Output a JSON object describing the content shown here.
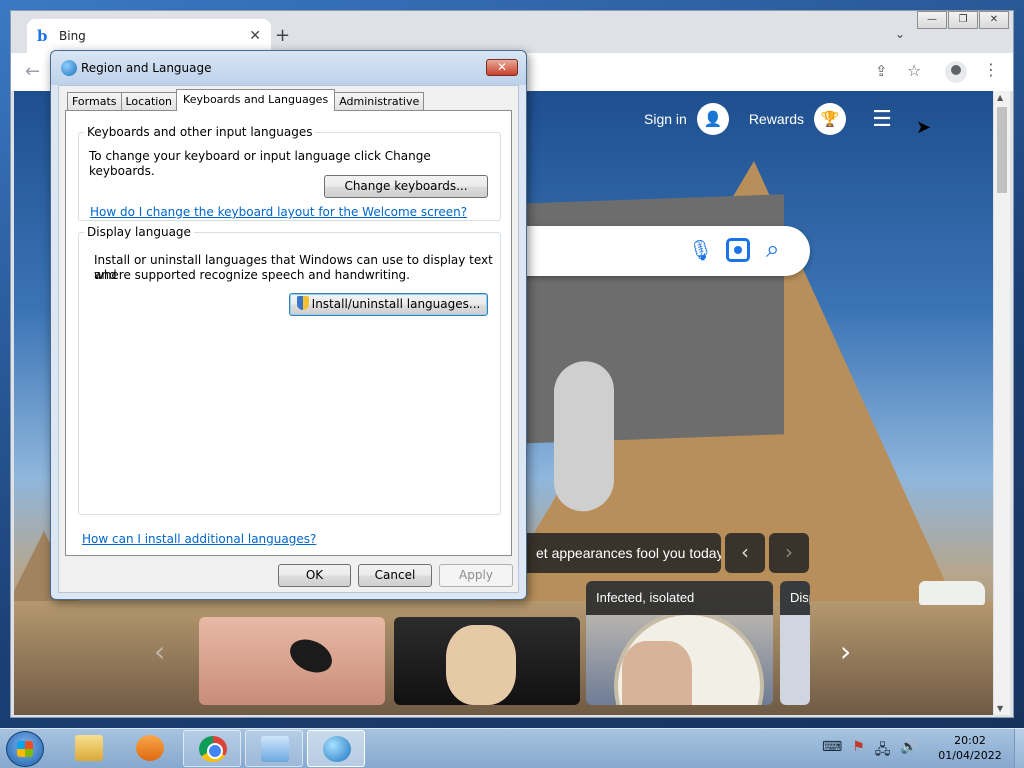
{
  "browser": {
    "tab_title": "Bing",
    "tab_close_glyph": "✕",
    "new_tab_glyph": "+",
    "tab_search_glyph": "⌄",
    "back_glyph": "←",
    "share_glyph": "⇪",
    "bookmark_glyph": "☆",
    "menu_glyph": "⋮",
    "caption": {
      "minimize": "—",
      "restore": "❐",
      "close": "✕"
    }
  },
  "bing": {
    "signin_label": "Sign in",
    "signin_icon": "user-icon",
    "rewards_label": "Rewards",
    "rewards_icon": "trophy-icon",
    "hamburger_glyph": "☰",
    "mic_glyph": "🎙",
    "search_glyph": "⌕",
    "headline": "et appearances fool you today",
    "prev_glyph": "‹",
    "next_glyph": "›",
    "carousel_right_glyph": "›",
    "carousel_left_glyph": "‹",
    "cards": [
      {
        "title": ""
      },
      {
        "title": ""
      },
      {
        "title": "Infected, isolated"
      },
      {
        "title": "Disp"
      }
    ]
  },
  "dialog": {
    "title": "Region and Language",
    "close_glyph": "✕",
    "tabs": [
      "Formats",
      "Location",
      "Keyboards and Languages",
      "Administrative"
    ],
    "active_tab": "Keyboards and Languages",
    "keyboards_group": {
      "legend": "Keyboards and other input languages",
      "description": "To change your keyboard or input language click Change keyboards.",
      "button": "Change keyboards...",
      "link": "How do I change the keyboard layout for the Welcome screen?"
    },
    "display_group": {
      "legend": "Display language",
      "description_line1": "Install or uninstall languages that Windows can use to display text and",
      "description_line2": "where supported recognize speech and handwriting.",
      "button": "Install/uninstall languages..."
    },
    "bottom_link": "How can I install additional languages?",
    "ok_label": "OK",
    "cancel_label": "Cancel",
    "apply_label": "Apply"
  },
  "taskbar": {
    "clock_time": "20:02",
    "clock_date": "01/04/2022",
    "tray_icons": [
      "keyboard-icon",
      "action-center-icon",
      "network-icon",
      "volume-icon"
    ],
    "tray_glyphs": {
      "keyboard": "⌨",
      "flag": "⚑",
      "network": "🖧",
      "volume": "🔊"
    }
  }
}
